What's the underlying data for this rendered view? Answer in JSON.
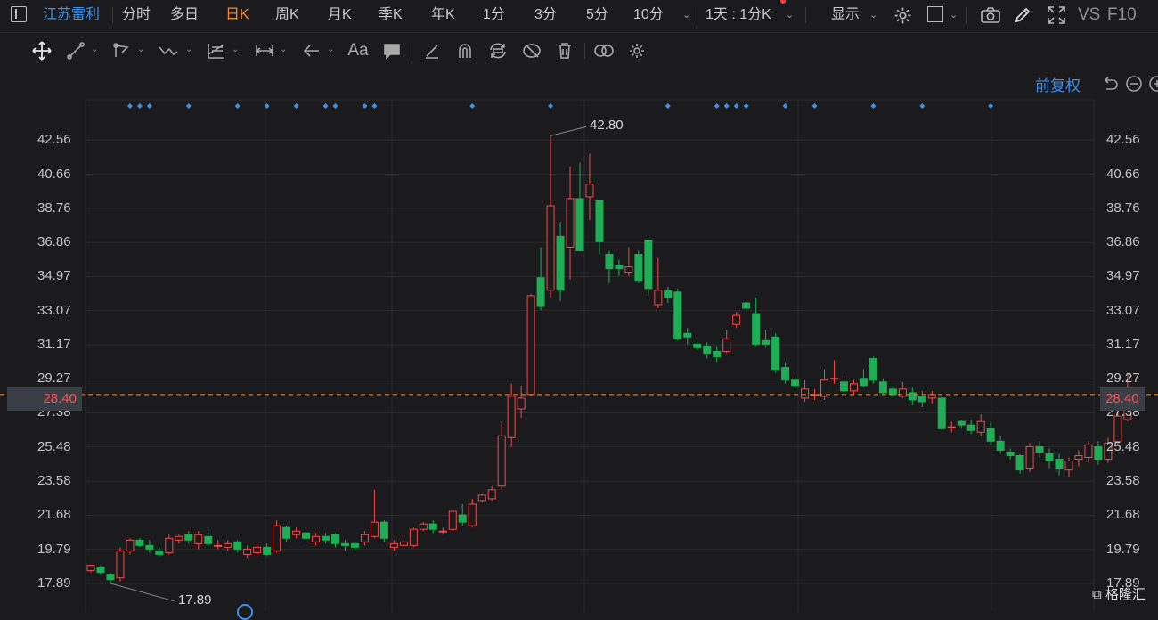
{
  "stock_name": "江苏雷利",
  "toolbar": {
    "periods": [
      "分时",
      "多日",
      "日K",
      "周K",
      "月K",
      "季K",
      "年K",
      "1分",
      "3分",
      "5分",
      "10分"
    ],
    "active_period": "日K",
    "multi_period": "1天 : 1分K",
    "display_label": "显示",
    "vs_label": "VS",
    "f10_label": "F10"
  },
  "draw_tools": [
    "move-icon",
    "line-icon",
    "polyline-icon",
    "wave-icon",
    "fib-icon",
    "range-icon",
    "arrow-icon",
    "text-icon",
    "comment-icon",
    "eraser-icon",
    "magnet-icon",
    "sync-icon",
    "hide-icon",
    "delete-icon",
    "link-icon",
    "settings-icon"
  ],
  "adjust_label": "前复权",
  "colors": {
    "up": "#f24b4b",
    "down": "#1fad55",
    "grid": "#2b2b2d",
    "current": "#ff8a26",
    "marker": "#3d8fe8"
  },
  "chart_data": {
    "type": "candlestick",
    "y_ticks": [
      "42.56",
      "40.66",
      "38.76",
      "36.86",
      "34.97",
      "33.07",
      "31.17",
      "29.27",
      "27.38",
      "25.48",
      "23.58",
      "21.68",
      "19.79",
      "17.89"
    ],
    "ylim": [
      16.4,
      44.8
    ],
    "current_price": "28.40",
    "high_label": "42.80",
    "low_label": "17.89",
    "high_index": 47,
    "low_index": 2,
    "event_marker_indices": [
      4,
      5,
      6,
      10,
      15,
      18,
      21,
      24,
      25,
      28,
      29,
      39,
      47,
      59,
      64,
      65,
      66,
      67,
      71,
      74,
      80,
      85,
      92
    ],
    "candles": [
      [
        18.6,
        18.9,
        18.5,
        18.7
      ],
      [
        18.8,
        18.5,
        18.9,
        18.4
      ],
      [
        18.4,
        18.1,
        18.5,
        17.89
      ],
      [
        18.2,
        19.7,
        19.9,
        18.0
      ],
      [
        19.7,
        20.3,
        20.4,
        19.5
      ],
      [
        20.3,
        20.0,
        20.4,
        19.9
      ],
      [
        20.0,
        19.8,
        20.3,
        19.6
      ],
      [
        19.7,
        19.5,
        19.9,
        19.4
      ],
      [
        19.6,
        20.4,
        20.6,
        19.5
      ],
      [
        20.3,
        20.5,
        20.6,
        20.1
      ],
      [
        20.6,
        20.3,
        20.8,
        20.1
      ],
      [
        20.1,
        20.6,
        20.8,
        19.8
      ],
      [
        20.5,
        20.1,
        20.9,
        20.0
      ],
      [
        20.0,
        20.0,
        20.3,
        19.8
      ],
      [
        19.9,
        20.1,
        20.3,
        19.7
      ],
      [
        20.2,
        19.8,
        20.3,
        19.6
      ],
      [
        19.5,
        19.8,
        20.0,
        19.3
      ],
      [
        19.6,
        19.9,
        20.1,
        19.4
      ],
      [
        19.9,
        19.5,
        20.1,
        19.4
      ],
      [
        19.7,
        21.1,
        21.4,
        19.6
      ],
      [
        21.0,
        20.4,
        21.1,
        20.2
      ],
      [
        20.6,
        20.8,
        21.0,
        20.4
      ],
      [
        20.7,
        20.4,
        20.8,
        20.2
      ],
      [
        20.2,
        20.5,
        20.7,
        20.0
      ],
      [
        20.5,
        20.3,
        20.7,
        20.1
      ],
      [
        20.6,
        20.1,
        20.7,
        19.9
      ],
      [
        20.1,
        20.0,
        20.3,
        19.7
      ],
      [
        20.1,
        19.9,
        20.2,
        19.7
      ],
      [
        20.2,
        20.6,
        20.8,
        20.0
      ],
      [
        20.5,
        21.3,
        23.1,
        20.4
      ],
      [
        21.3,
        20.4,
        21.4,
        20.2
      ],
      [
        19.9,
        20.1,
        20.3,
        19.7
      ],
      [
        20.0,
        20.2,
        20.4,
        19.9
      ],
      [
        20.0,
        20.9,
        21.0,
        19.9
      ],
      [
        20.9,
        21.2,
        21.3,
        20.8
      ],
      [
        21.2,
        20.9,
        21.4,
        20.7
      ],
      [
        20.8,
        20.8,
        21.0,
        20.6
      ],
      [
        20.9,
        21.9,
        21.9,
        20.8
      ],
      [
        21.7,
        21.3,
        22.3,
        21.1
      ],
      [
        21.1,
        22.3,
        22.6,
        21.0
      ],
      [
        22.5,
        22.8,
        22.9,
        22.4
      ],
      [
        22.6,
        23.1,
        23.3,
        22.5
      ],
      [
        23.3,
        26.1,
        26.9,
        23.1
      ],
      [
        26.0,
        28.3,
        29.0,
        25.5
      ],
      [
        27.6,
        28.2,
        28.9,
        27.1
      ],
      [
        28.4,
        33.9,
        34.0,
        28.3
      ],
      [
        34.9,
        33.3,
        36.6,
        33.1
      ],
      [
        34.2,
        38.9,
        42.8,
        33.8
      ],
      [
        37.2,
        34.2,
        38.0,
        33.6
      ],
      [
        36.6,
        39.3,
        41.1,
        34.8
      ],
      [
        39.3,
        36.4,
        41.3,
        36.4
      ],
      [
        39.4,
        40.1,
        41.8,
        38.1
      ],
      [
        39.2,
        36.9,
        39.2,
        36.2
      ],
      [
        36.2,
        35.4,
        36.4,
        34.6
      ],
      [
        35.6,
        35.4,
        35.9,
        35.0
      ],
      [
        35.2,
        35.5,
        36.6,
        35.0
      ],
      [
        36.2,
        34.7,
        36.4,
        34.6
      ],
      [
        37.0,
        34.3,
        37.0,
        33.9
      ],
      [
        33.4,
        34.2,
        36.0,
        33.2
      ],
      [
        34.2,
        33.8,
        34.4,
        33.5
      ],
      [
        34.1,
        31.5,
        34.3,
        31.4
      ],
      [
        31.8,
        31.6,
        32.1,
        31.2
      ],
      [
        31.2,
        31.0,
        31.4,
        30.9
      ],
      [
        31.1,
        30.7,
        31.3,
        30.4
      ],
      [
        30.8,
        30.5,
        31.1,
        30.2
      ],
      [
        30.8,
        31.5,
        32.0,
        30.7
      ],
      [
        32.3,
        32.8,
        33.0,
        32.1
      ],
      [
        33.5,
        33.2,
        33.6,
        33.0
      ],
      [
        32.9,
        31.2,
        33.8,
        31.1
      ],
      [
        31.4,
        31.2,
        32.0,
        31.0
      ],
      [
        31.6,
        29.8,
        31.8,
        29.6
      ],
      [
        29.9,
        29.2,
        30.2,
        29.0
      ],
      [
        29.2,
        28.9,
        29.4,
        28.7
      ],
      [
        28.2,
        28.7,
        29.2,
        28.0
      ],
      [
        28.4,
        28.4,
        28.7,
        28.1
      ],
      [
        28.3,
        29.2,
        29.8,
        28.1
      ],
      [
        29.3,
        29.3,
        30.3,
        29.0
      ],
      [
        29.1,
        28.6,
        29.6,
        28.5
      ],
      [
        28.6,
        29.0,
        29.2,
        28.4
      ],
      [
        29.3,
        28.9,
        29.8,
        28.8
      ],
      [
        30.4,
        29.2,
        30.5,
        29.0
      ],
      [
        29.1,
        28.5,
        29.3,
        28.4
      ],
      [
        28.7,
        28.4,
        28.9,
        28.2
      ],
      [
        28.3,
        28.7,
        29.1,
        28.2
      ],
      [
        28.5,
        28.1,
        28.8,
        27.8
      ],
      [
        28.3,
        28.0,
        28.6,
        27.7
      ],
      [
        28.2,
        28.4,
        28.6,
        27.9
      ],
      [
        28.2,
        26.5,
        28.3,
        26.4
      ],
      [
        26.6,
        26.6,
        26.9,
        26.3
      ],
      [
        26.9,
        26.7,
        27.0,
        26.5
      ],
      [
        26.7,
        26.4,
        27.0,
        26.2
      ],
      [
        26.3,
        26.9,
        27.3,
        26.1
      ],
      [
        26.5,
        25.8,
        26.9,
        25.6
      ],
      [
        25.8,
        25.3,
        26.1,
        25.1
      ],
      [
        25.2,
        25.0,
        25.4,
        24.8
      ],
      [
        25.0,
        24.2,
        25.1,
        24.0
      ],
      [
        24.3,
        25.5,
        25.7,
        24.1
      ],
      [
        25.5,
        25.2,
        25.8,
        24.9
      ],
      [
        25.1,
        24.7,
        25.4,
        24.3
      ],
      [
        24.8,
        24.3,
        25.1,
        23.9
      ],
      [
        24.2,
        24.7,
        24.9,
        23.8
      ],
      [
        24.8,
        25.0,
        25.3,
        24.4
      ],
      [
        24.9,
        25.6,
        25.8,
        24.6
      ],
      [
        25.5,
        24.8,
        25.8,
        24.5
      ],
      [
        24.8,
        25.7,
        26.0,
        24.6
      ],
      [
        25.8,
        27.2,
        28.5,
        25.6
      ],
      [
        27.0,
        28.4,
        29.6,
        26.9
      ]
    ]
  }
}
